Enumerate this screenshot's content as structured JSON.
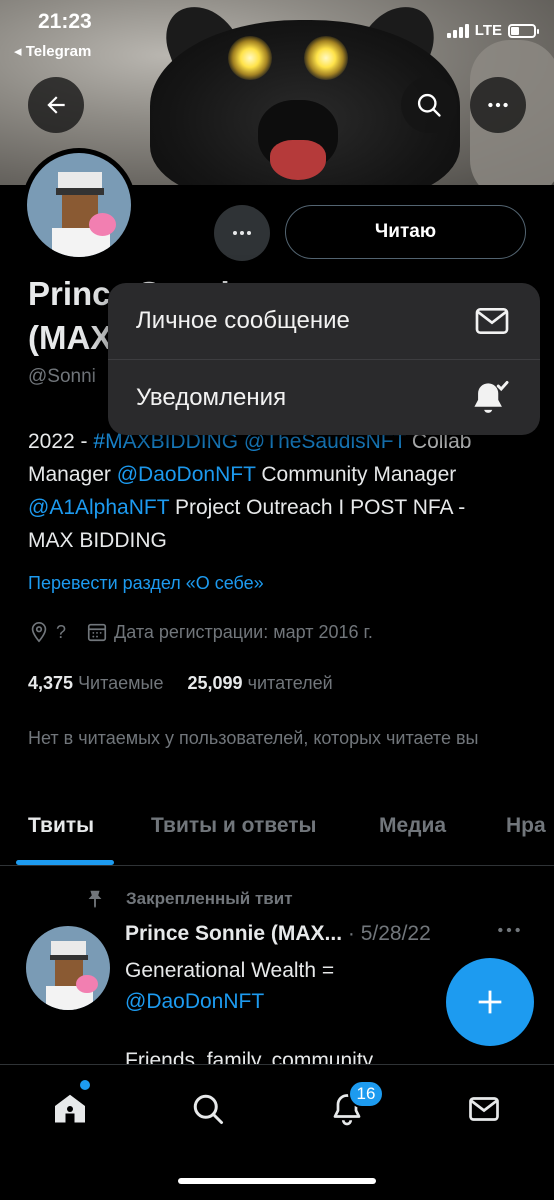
{
  "status_bar": {
    "time": "21:23",
    "back_app": "◂ Telegram",
    "network": "LTE"
  },
  "profile": {
    "follow_label": "Читаю",
    "name_line1": "Prince Sonnie",
    "name_line2": "(MAX",
    "handle": "@Sonni",
    "bio": [
      {
        "text": "2022 - ",
        "link": false
      },
      {
        "text": "#MAXBIDDING @TheSaudisNFT",
        "link": true
      },
      {
        "text": " Collab Manager ",
        "link": false
      },
      {
        "text": "@DaoDonNFT",
        "link": true
      },
      {
        "text": " Community Manager ",
        "link": false
      },
      {
        "text": "@A1AlphaNFT",
        "link": true
      },
      {
        "text": " Project Outreach I POST NFA - MAX BIDDING",
        "link": false
      }
    ],
    "translate_label": "Перевести раздел «О себе»",
    "location": "?",
    "joined": "Дата регистрации: март 2016 г.",
    "following_count": "4,375",
    "following_label": "Читаемые",
    "followers_count": "25,099",
    "followers_label": "читателей",
    "note": "Нет в читаемых у пользователей, которых читаете вы"
  },
  "tabs": [
    {
      "label": "Твиты",
      "active": true
    },
    {
      "label": "Твиты и ответы",
      "active": false
    },
    {
      "label": "Медиа",
      "active": false
    },
    {
      "label": "Нра",
      "active": false
    }
  ],
  "pinned_tweet": {
    "pinned_label": "Закрепленный твит",
    "author": "Prince Sonnie (MAX...",
    "date": "· 5/28/22",
    "text_line1": "Generational Wealth =",
    "mention": "@DaoDonNFT",
    "text_line2": "Friends, family, community"
  },
  "menu": {
    "items": [
      {
        "label": "Личное сообщение",
        "icon": "envelope-icon"
      },
      {
        "label": "Уведомления",
        "icon": "bell-check-icon"
      }
    ]
  },
  "nav": {
    "notifications_count": "16"
  },
  "colors": {
    "accent": "#1d9bf0",
    "background": "#000000",
    "muted": "#71767b",
    "menu_bg": "#2a2a2c"
  }
}
